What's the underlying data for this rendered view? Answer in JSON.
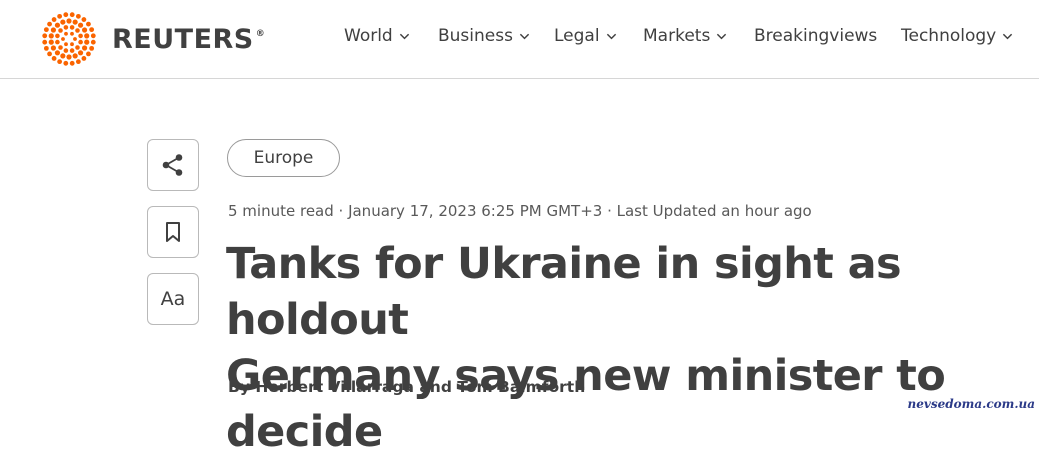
{
  "header": {
    "logo_text": "REUTERS",
    "logo_mark": "®",
    "logo_color": "#fa6400",
    "nav": [
      {
        "label": "World",
        "has_dropdown": true
      },
      {
        "label": "Business",
        "has_dropdown": true
      },
      {
        "label": "Legal",
        "has_dropdown": true
      },
      {
        "label": "Markets",
        "has_dropdown": true
      },
      {
        "label": "Breakingviews",
        "has_dropdown": false
      },
      {
        "label": "Technology",
        "has_dropdown": true
      }
    ]
  },
  "sidebar": {
    "share_icon": "share-icon",
    "bookmark_icon": "bookmark-icon",
    "text_size_label": "Aa"
  },
  "article": {
    "section": "Europe",
    "meta": "5 minute read · January 17, 2023 6:25 PM GMT+3 · Last Updated an hour ago",
    "headline_line1": "Tanks for Ukraine in sight as holdout",
    "headline_line2": "Germany says new minister to decide",
    "byline": "By Herbert Villarraga and Tom Balmforth"
  },
  "watermark": "nevsedoma.com.ua"
}
